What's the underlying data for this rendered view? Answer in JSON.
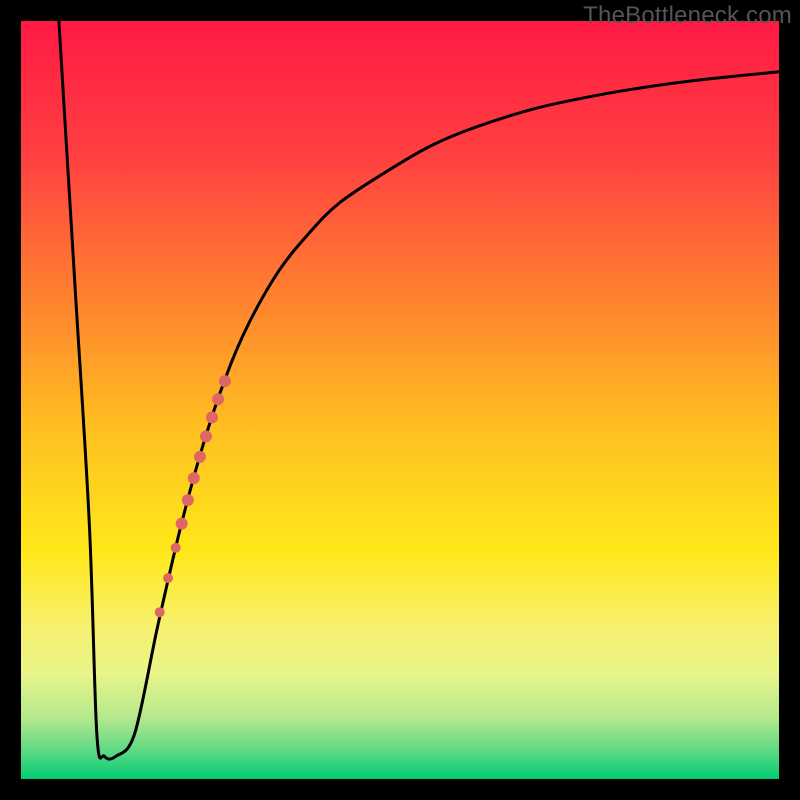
{
  "watermark": "TheBottleneck.com",
  "colors": {
    "gradient_stops": [
      {
        "offset": 0.0,
        "color": "#ff1a44"
      },
      {
        "offset": 0.18,
        "color": "#ff4040"
      },
      {
        "offset": 0.36,
        "color": "#ff8030"
      },
      {
        "offset": 0.54,
        "color": "#ffc020"
      },
      {
        "offset": 0.7,
        "color": "#ffe81a"
      },
      {
        "offset": 0.8,
        "color": "#f8f070"
      },
      {
        "offset": 0.86,
        "color": "#e8f589"
      },
      {
        "offset": 0.92,
        "color": "#b4e88c"
      },
      {
        "offset": 0.965,
        "color": "#58d884"
      },
      {
        "offset": 1.0,
        "color": "#00cc73"
      }
    ],
    "curve": "#000000",
    "marker_fill": "#e06666",
    "marker_stroke": "#c94444"
  },
  "chart_data": {
    "type": "line",
    "title": "",
    "xlabel": "",
    "ylabel": "",
    "xlim": [
      0,
      100
    ],
    "ylim": [
      0,
      100
    ],
    "series": [
      {
        "name": "bottleneck-curve",
        "x": [
          5,
          7,
          9,
          10,
          11,
          12.5,
          15,
          18,
          21,
          24,
          27,
          30,
          34,
          38,
          42,
          48,
          54,
          60,
          68,
          76,
          84,
          92,
          100
        ],
        "y": [
          100,
          67,
          34,
          6,
          3,
          3,
          6,
          20,
          33,
          44,
          53,
          60,
          67,
          72,
          76,
          80,
          83.5,
          86,
          88.5,
          90.2,
          91.5,
          92.5,
          93.3
        ]
      }
    ],
    "markers": {
      "name": "highlight-segment",
      "points": [
        {
          "x": 18.3,
          "y": 22.0,
          "r": 5
        },
        {
          "x": 19.4,
          "y": 26.5,
          "r": 5
        },
        {
          "x": 20.4,
          "y": 30.5,
          "r": 5
        },
        {
          "x": 21.2,
          "y": 33.7,
          "r": 6
        },
        {
          "x": 22.0,
          "y": 36.8,
          "r": 6
        },
        {
          "x": 22.8,
          "y": 39.7,
          "r": 6
        },
        {
          "x": 23.6,
          "y": 42.5,
          "r": 6
        },
        {
          "x": 24.4,
          "y": 45.2,
          "r": 6
        },
        {
          "x": 25.2,
          "y": 47.7,
          "r": 6
        },
        {
          "x": 26.0,
          "y": 50.1,
          "r": 6
        },
        {
          "x": 26.9,
          "y": 52.5,
          "r": 6
        }
      ]
    }
  }
}
